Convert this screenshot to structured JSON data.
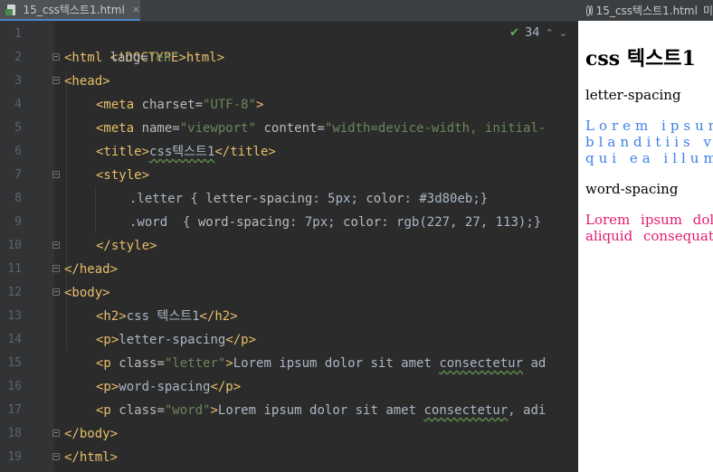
{
  "editor": {
    "tab_label": "15_css텍스트1.html",
    "tab_close": "×",
    "inspection": {
      "check": "✔",
      "count": "34",
      "up": "⌃",
      "down": "⌄"
    },
    "line_numbers": [
      "1",
      "2",
      "3",
      "4",
      "5",
      "6",
      "7",
      "8",
      "9",
      "10",
      "11",
      "12",
      "13",
      "14",
      "15",
      "16",
      "17",
      "18",
      "19"
    ],
    "code": {
      "l1": {
        "t1": "<!DOCTYPE html>"
      },
      "l2": {
        "t1": "<html ",
        "a1": "lang=",
        "v1": "\"en\"",
        "t2": ">"
      },
      "l3": {
        "t1": "<head>"
      },
      "l4": {
        "t1": "<meta ",
        "a1": "charset=",
        "v1": "\"UTF-8\"",
        "t2": ">"
      },
      "l5": {
        "t1": "<meta ",
        "a1": "name=",
        "v1": "\"viewport\"",
        "a2": " content=",
        "v2": "\"width=device-width, initial-"
      },
      "l6": {
        "t1": "<title>",
        "x1": "css텍스트1",
        "t2": "</title>"
      },
      "l7": {
        "t1": "<style>"
      },
      "l8": {
        "s1": ".letter { ",
        "p1": "letter-spacing",
        "r1": ": 5px; ",
        "p2": "color",
        "r2": ": #3d80eb;}"
      },
      "l9": {
        "s1": ".word  { ",
        "p1": "word-spacing",
        "r1": ": 7px; ",
        "p2": "color",
        "r2": ": rgb(227, 27, 113);}"
      },
      "l10": {
        "t1": "</style>"
      },
      "l11": {
        "t1": "</head>"
      },
      "l12": {
        "t1": "<body>"
      },
      "l13": {
        "t1": "<h2>",
        "x1": "css 텍스트1",
        "t2": "</h2>"
      },
      "l14": {
        "t1": "<p>",
        "x1": "letter-spacing",
        "t2": "</p>"
      },
      "l15": {
        "t1": "<p ",
        "a1": "class=",
        "v1": "\"letter\"",
        "t2": ">",
        "x1": "Lorem ipsum dolor sit amet ",
        "x2": "consectetur",
        "x3": " ad"
      },
      "l16": {
        "t1": "<p>",
        "x1": "word-spacing",
        "t2": "</p>"
      },
      "l17": {
        "t1": "<p ",
        "a1": "class=",
        "v1": "\"word\"",
        "t2": ">",
        "x1": "Lorem ipsum dolor sit amet ",
        "x2": "consectetur",
        "x3": ", adi"
      },
      "l18": {
        "t1": "</body>"
      },
      "l19": {
        "t1": "</html>"
      }
    }
  },
  "preview": {
    "tab_label": "15_css텍스트1.html",
    "more": "미",
    "h2": "css 텍스트1",
    "p_letter_label": "letter-spacing",
    "letter_text": "Lorem ipsum dolor blanditiis vel qui ea illum",
    "letter_line1": "Lorem ipsum",
    "letter_line2": "blanditiis ve",
    "letter_line3": "qui ea illum",
    "p_word_label": "word-spacing",
    "word_line1": "Lorem ipsum dolor",
    "word_line2": "aliquid consequatur"
  },
  "colors": {
    "letter": "#3d80eb",
    "word": "rgb(227, 27, 113)",
    "tag": "#e8bf6a",
    "attr_value": "#6a8759"
  }
}
